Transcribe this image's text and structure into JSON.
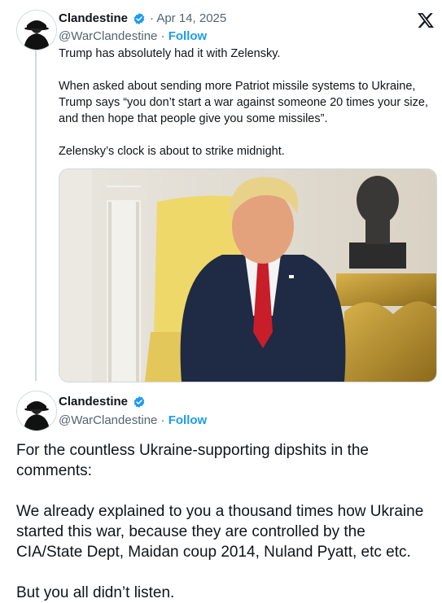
{
  "tweet1": {
    "name": "Clandestine",
    "date": "· Apr 14, 2025",
    "handle": "@WarClandestine",
    "separator": " · ",
    "follow": "Follow",
    "text": "Trump has absolutely had it with Zelensky.\n\nWhen asked about sending more Patriot missile systems to Ukraine, Trump says “you don’t start a war against someone 20 times your size, and then hope that people give you some missiles”.\n\nZelensky’s clock is about to strike midnight."
  },
  "tweet2": {
    "name": "Clandestine",
    "handle": "@WarClandestine",
    "separator": " · ",
    "follow": "Follow",
    "text": "For the countless Ukraine-supporting dipshits in the comments:\n\nWe already explained to you a thousand times how Ukraine started this war, because they are controlled by the CIA/State Dept, Maidan coup 2014, Nuland Pyatt, etc etc.\n\nBut you all didn’t listen."
  },
  "icons": {
    "platform_logo": "x-logo-icon",
    "verified": "verified-badge-icon",
    "avatar": "hooded-figure-avatar"
  },
  "colors": {
    "accent": "#1d9bf0",
    "secondary_text": "#536471",
    "text": "#0f1419"
  }
}
